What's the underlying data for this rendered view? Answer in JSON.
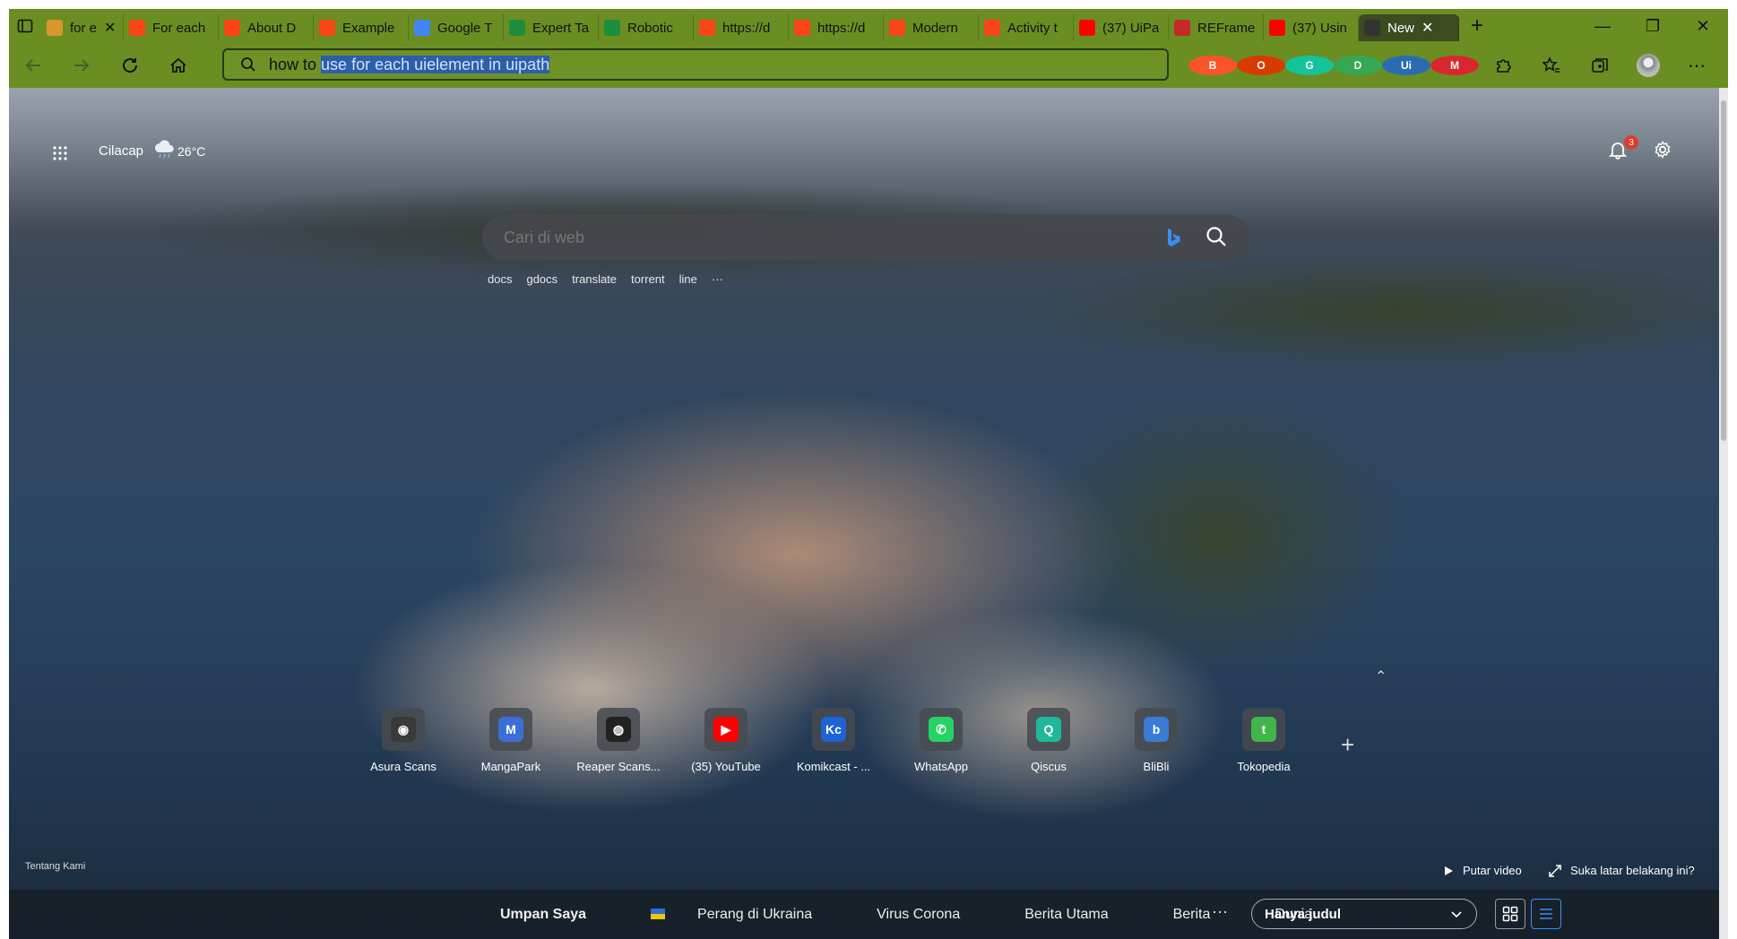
{
  "browser": {
    "tabs": [
      {
        "title": "for e",
        "icon": "google-chrome-icon",
        "color": "#d9962b"
      },
      {
        "title": "For each",
        "icon": "uipath-icon",
        "color": "#fa4616"
      },
      {
        "title": "About D",
        "icon": "uipath-icon",
        "color": "#fa4616"
      },
      {
        "title": "Example",
        "icon": "uipath-icon",
        "color": "#fa4616"
      },
      {
        "title": "Google T",
        "icon": "google-translate-icon",
        "color": "#4285f4"
      },
      {
        "title": "Expert Ta",
        "icon": "sheets-icon",
        "color": "#1e8e3e"
      },
      {
        "title": "Robotic",
        "icon": "sheets-icon",
        "color": "#1e8e3e"
      },
      {
        "title": "https://d",
        "icon": "uipath-icon",
        "color": "#fa4616"
      },
      {
        "title": "https://d",
        "icon": "uipath-icon",
        "color": "#fa4616"
      },
      {
        "title": "Modern",
        "icon": "uipath-icon",
        "color": "#fa4616"
      },
      {
        "title": "Activity t",
        "icon": "uipath-icon",
        "color": "#fa4616"
      },
      {
        "title": "(37) UiPa",
        "icon": "youtube-icon",
        "color": "#ff0000"
      },
      {
        "title": "REFrame",
        "icon": "pdf-icon",
        "color": "#c62828"
      },
      {
        "title": "(37) Usin",
        "icon": "youtube-icon",
        "color": "#ff0000"
      },
      {
        "title": "New",
        "icon": "newtab-icon",
        "color": "#333333",
        "active": true
      }
    ],
    "address_typed": "how to ",
    "address_suggest": "use for each uielement in uipath",
    "extensions": [
      {
        "name": "brave-icon",
        "color": "#fb542b",
        "char": "B"
      },
      {
        "name": "office-icon",
        "color": "#d83b01",
        "char": "O"
      },
      {
        "name": "grammarly-icon",
        "color": "#15c39a",
        "char": "G"
      },
      {
        "name": "drive-icon",
        "color": "#34a853",
        "char": "D"
      },
      {
        "name": "uipath-ext-icon",
        "color": "#2b6cb0",
        "char": "Ui"
      },
      {
        "name": "mega-icon",
        "color": "#d9272e",
        "char": "M"
      }
    ]
  },
  "newtab": {
    "location": "Cilacap",
    "temperature": "26°C",
    "notification_count": "3",
    "search_placeholder": "Cari di web",
    "suggestions": [
      "docs",
      "gdocs",
      "translate",
      "torrent",
      "line",
      "···"
    ],
    "quick_links": [
      {
        "label": "Asura Scans",
        "icon": "asura-scans-icon",
        "color": "#3a3a3a",
        "char": "◉"
      },
      {
        "label": "MangaPark",
        "icon": "mangapark-icon",
        "color": "#3b6fd6",
        "char": "M"
      },
      {
        "label": "Reaper Scans...",
        "icon": "reaper-scans-icon",
        "color": "#222222",
        "char": "◍"
      },
      {
        "label": "(35) YouTube",
        "icon": "youtube-icon",
        "color": "#ff0000",
        "char": "▶"
      },
      {
        "label": "Komikcast - ...",
        "icon": "komikcast-icon",
        "color": "#1e63d6",
        "char": "Kc"
      },
      {
        "label": "WhatsApp",
        "icon": "whatsapp-icon",
        "color": "#25d366",
        "char": "✆"
      },
      {
        "label": "Qiscus",
        "icon": "qiscus-icon",
        "color": "#1fb89a",
        "char": "Q"
      },
      {
        "label": "BliBli",
        "icon": "blibli-icon",
        "color": "#3a7bd5",
        "char": "b"
      },
      {
        "label": "Tokopedia",
        "icon": "tokopedia-icon",
        "color": "#42b549",
        "char": "t"
      }
    ],
    "about_link": "Tentang Kami",
    "play_video": "Putar video",
    "like_background": "Suka latar belakang ini?",
    "feed_tabs": [
      "Umpan Saya",
      "Perang di Ukraina",
      "Virus Corona",
      "Berita Utama",
      "Berita",
      "Dunia"
    ],
    "more": "···",
    "view_dropdown": "Hanya judul"
  }
}
